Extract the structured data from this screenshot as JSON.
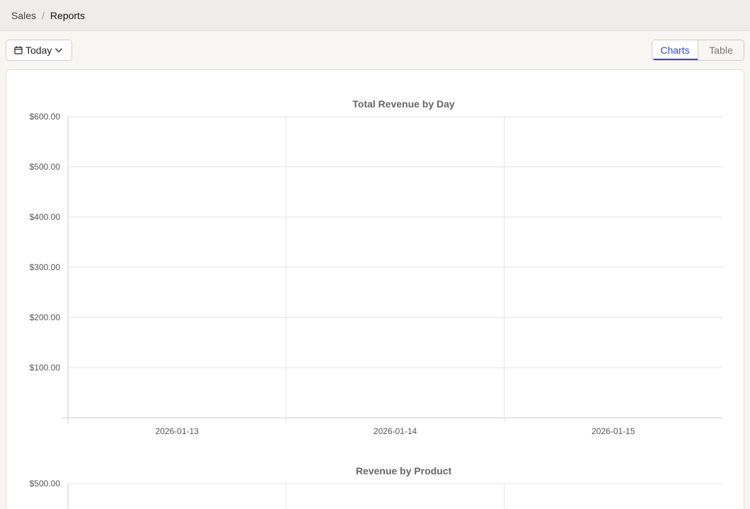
{
  "breadcrumb": {
    "items": [
      "Sales",
      "Reports"
    ],
    "separator": "/"
  },
  "toolbar": {
    "date_filter": "Today",
    "view_toggle": [
      "Charts",
      "Table"
    ],
    "active_view": "Charts"
  },
  "colors": {
    "accent": "#2c4fb8"
  },
  "chart_data": [
    {
      "type": "bar",
      "title": "Total Revenue by Day",
      "categories": [
        "2026-01-13",
        "2026-01-14",
        "2026-01-15"
      ],
      "values": [],
      "y_ticks": [
        "$100.00",
        "$200.00",
        "$300.00",
        "$400.00",
        "$500.00",
        "$600.00"
      ],
      "ylim": [
        0,
        600
      ],
      "grid": true
    },
    {
      "type": "bar",
      "title": "Revenue by Product",
      "categories": [],
      "values": [],
      "y_ticks": [
        "$500.00"
      ],
      "grid": true
    }
  ]
}
